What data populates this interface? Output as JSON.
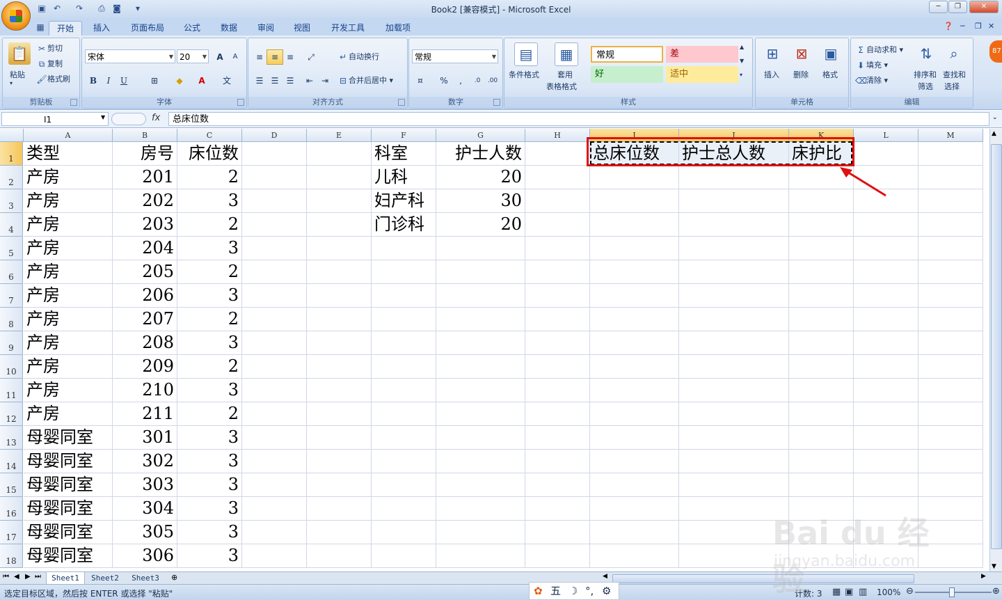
{
  "window": {
    "title": "Book2  [兼容模式] - Microsoft Excel",
    "minimize": "─",
    "restore": "❐",
    "close": "✕"
  },
  "ribbon": {
    "tabs": [
      "开始",
      "插入",
      "页面布局",
      "公式",
      "数据",
      "审阅",
      "视图",
      "开发工具",
      "加载项"
    ],
    "active_tab": "开始",
    "clipboard": {
      "label": "剪贴板",
      "paste": "粘贴",
      "cut": "剪切",
      "copy": "复制",
      "format_painter": "格式刷"
    },
    "font": {
      "label": "字体",
      "name": "宋体",
      "size": "20",
      "grow": "A",
      "shrink": "A",
      "bold": "B",
      "italic": "I",
      "underline": "U"
    },
    "alignment": {
      "label": "对齐方式",
      "wrap": "自动换行",
      "merge": "合并后居中"
    },
    "number": {
      "label": "数字",
      "format": "常规",
      "percent": "%",
      "comma": ","
    },
    "styles": {
      "label": "样式",
      "conditional": "条件格式",
      "table_1": "套用",
      "table_2": "表格格式",
      "normal": "常规",
      "bad": "差",
      "good": "好",
      "neutral": "适中"
    },
    "cells": {
      "label": "单元格",
      "insert": "插入",
      "delete": "删除",
      "format": "格式"
    },
    "editing": {
      "label": "编辑",
      "autosum": "自动求和",
      "fill": "填充",
      "clear": "清除",
      "sort_1": "排序和",
      "sort_2": "筛选",
      "find_1": "查找和",
      "find_2": "选择"
    }
  },
  "formula_bar": {
    "name_box": "I1",
    "fx": "fx",
    "content": "总床位数"
  },
  "columns": [
    "A",
    "B",
    "C",
    "D",
    "E",
    "F",
    "G",
    "H",
    "I",
    "J",
    "K",
    "L",
    "M"
  ],
  "rows": [
    {
      "n": "1",
      "A": "类型",
      "B": "房号",
      "C": "床位数",
      "F": "科室",
      "G": "护士人数",
      "I": "总床位数",
      "J": "护士总人数",
      "K": "床护比"
    },
    {
      "n": "2",
      "A": "产房",
      "B": "201",
      "C": "2",
      "F": "儿科",
      "G": "20"
    },
    {
      "n": "3",
      "A": "产房",
      "B": "202",
      "C": "3",
      "F": "妇产科",
      "G": "30"
    },
    {
      "n": "4",
      "A": "产房",
      "B": "203",
      "C": "2",
      "F": "门诊科",
      "G": "20"
    },
    {
      "n": "5",
      "A": "产房",
      "B": "204",
      "C": "3"
    },
    {
      "n": "6",
      "A": "产房",
      "B": "205",
      "C": "2"
    },
    {
      "n": "7",
      "A": "产房",
      "B": "206",
      "C": "3"
    },
    {
      "n": "8",
      "A": "产房",
      "B": "207",
      "C": "2"
    },
    {
      "n": "9",
      "A": "产房",
      "B": "208",
      "C": "3"
    },
    {
      "n": "10",
      "A": "产房",
      "B": "209",
      "C": "2"
    },
    {
      "n": "11",
      "A": "产房",
      "B": "210",
      "C": "3"
    },
    {
      "n": "12",
      "A": "产房",
      "B": "211",
      "C": "2"
    },
    {
      "n": "13",
      "A": "母婴同室",
      "B": "301",
      "C": "3"
    },
    {
      "n": "14",
      "A": "母婴同室",
      "B": "302",
      "C": "3"
    },
    {
      "n": "15",
      "A": "母婴同室",
      "B": "303",
      "C": "3"
    },
    {
      "n": "16",
      "A": "母婴同室",
      "B": "304",
      "C": "3"
    },
    {
      "n": "17",
      "A": "母婴同室",
      "B": "305",
      "C": "3"
    },
    {
      "n": "18",
      "A": "母婴同室",
      "B": "306",
      "C": "3"
    }
  ],
  "sheets": [
    "Sheet1",
    "Sheet2",
    "Sheet3"
  ],
  "active_sheet": "Sheet1",
  "status": {
    "message": "选定目标区域，然后按 ENTER 或选择 \"粘贴\"",
    "count": "计数: 3",
    "zoom": "100%"
  },
  "ime": {
    "label": "五"
  },
  "badge": "87",
  "watermark": {
    "brand": "Bai du 经验",
    "url": "jingyan.baidu.com"
  },
  "colors": {
    "selection_border": "#000000",
    "annotation_red": "#e01010",
    "ribbon_bg": "#d5e3f5",
    "header_selected": "#f5c65a"
  }
}
